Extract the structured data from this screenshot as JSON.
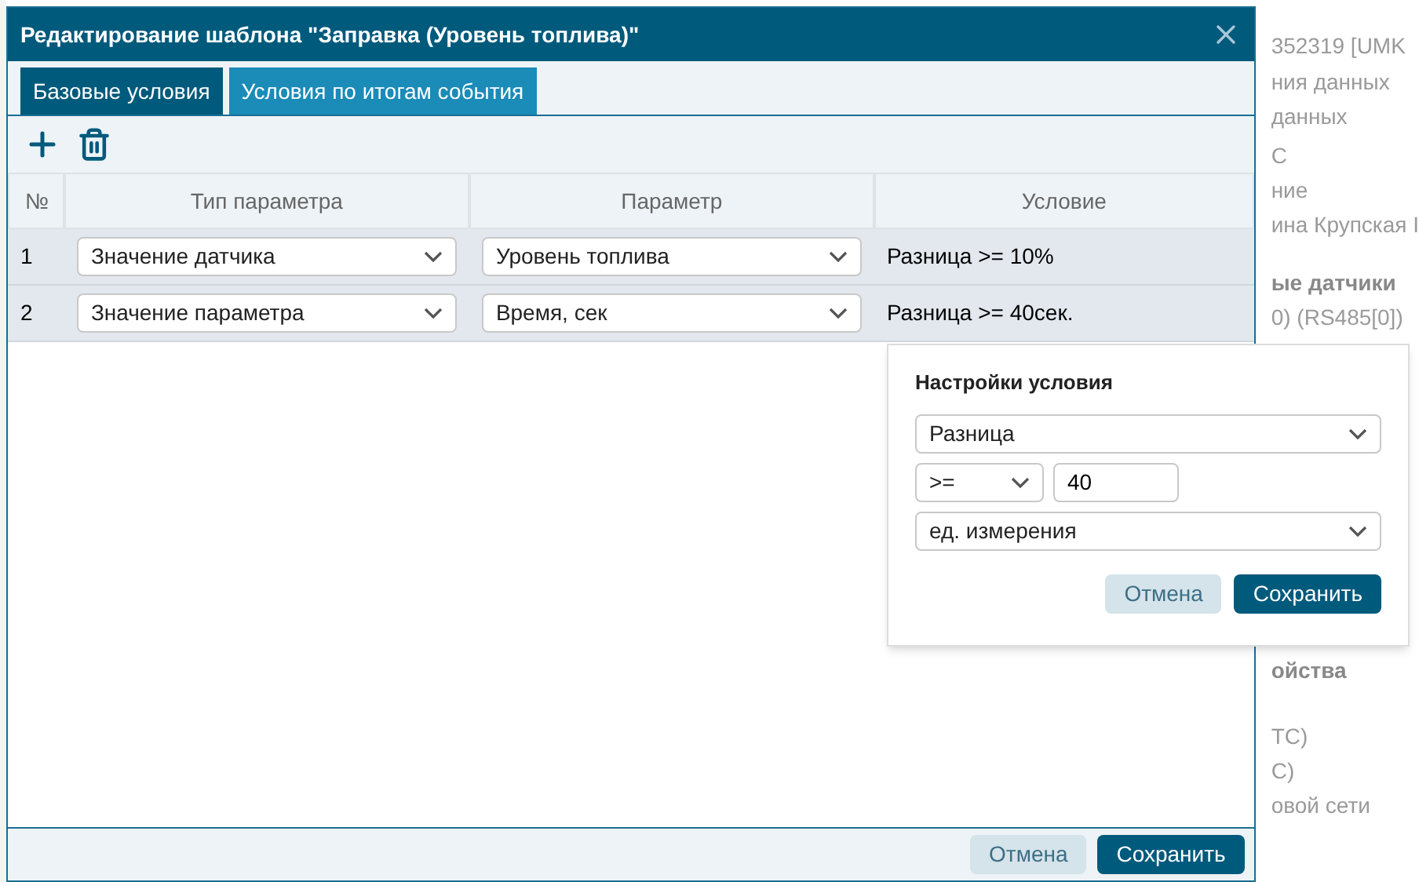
{
  "background_panel": {
    "groups": [
      {
        "items": [
          {
            "text": "352319 [UMK",
            "bold": false
          }
        ]
      },
      {
        "items": [
          {
            "text": "ния данных",
            "bold": false
          },
          {
            "text": "данных",
            "bold": false
          }
        ]
      },
      {
        "items": [
          {
            "text": "С",
            "bold": false
          },
          {
            "text": "ние",
            "bold": false
          },
          {
            "text": "ина Крупская І",
            "bold": false
          }
        ]
      },
      {
        "items": [
          {
            "text": "ые датчики",
            "bold": true
          },
          {
            "text": "0) (RS485[0])",
            "bold": false
          }
        ]
      },
      {
        "items": [
          {
            "text": "ойства",
            "bold": true
          }
        ]
      },
      {
        "items": [
          {
            "text": "ТС)",
            "bold": false
          },
          {
            "text": "С)",
            "bold": false
          },
          {
            "text": "овой сети",
            "bold": false
          }
        ]
      }
    ]
  },
  "dialog": {
    "title": "Редактирование шаблона \"Заправка (Уровень топлива)\"",
    "tabs": [
      {
        "label": "Базовые условия",
        "selected": true
      },
      {
        "label": "Условия по итогам события",
        "selected": false
      }
    ],
    "table": {
      "columns": [
        "№",
        "Тип параметра",
        "Параметр",
        "Условие"
      ],
      "rows": [
        {
          "number": "1",
          "param_type": "Значение датчика",
          "param": "Уровень топлива",
          "condition": "Разница >= 10%"
        },
        {
          "number": "2",
          "param_type": "Значение параметра",
          "param": "Время, сек",
          "condition": "Разница >= 40сек."
        }
      ]
    },
    "buttons": [
      {
        "label": "Отмена",
        "kind": "secondary"
      },
      {
        "label": "Сохранить",
        "kind": "primary"
      }
    ]
  },
  "condition_popup": {
    "title": "Настройки условия",
    "function": "Разница",
    "operator": ">=",
    "value": "40",
    "unit": "ед. измерения",
    "buttons": [
      {
        "label": "Отмена",
        "kind": "secondary"
      },
      {
        "label": "Сохранить",
        "kind": "primary"
      }
    ]
  }
}
